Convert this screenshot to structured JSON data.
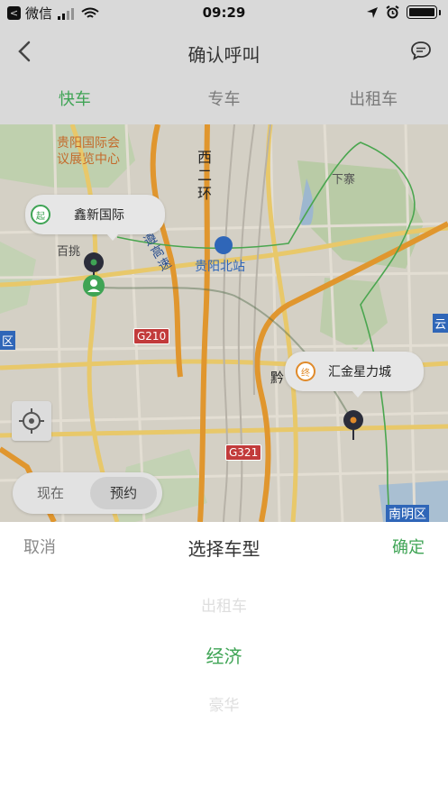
{
  "status_bar": {
    "carrier": "微信",
    "time": "09:29",
    "back_glyph": "<"
  },
  "nav": {
    "title": "确认呼叫",
    "back_icon": "back-arrow-icon",
    "chat_icon": "chat-bubble-icon"
  },
  "tabs": [
    {
      "label": "快车",
      "active": true
    },
    {
      "label": "专车",
      "active": false
    },
    {
      "label": "出租车",
      "active": false
    }
  ],
  "map": {
    "labels": {
      "expo": "贵阳国际会\n议展览中心",
      "xi_er_huan": "西\n二\n环",
      "xia_zhai": "下寨",
      "baitiao": "百挑",
      "expressway": "遵\n高\n速",
      "north_station": "贵阳北站",
      "g210": "G210",
      "g321": "G321",
      "qian": "黔",
      "yun": "云",
      "qu": "区",
      "nanming": "南明区"
    },
    "origin": {
      "badge": "起",
      "name": "鑫新国际"
    },
    "destination": {
      "badge": "终",
      "name": "汇金星力城"
    },
    "time_toggle": {
      "now": "现在",
      "reserve": "预约",
      "selected": "预约"
    },
    "colors": {
      "green": "#3fa455",
      "orange": "#e08a2a",
      "shield_red": "#c23b3b"
    }
  },
  "picker": {
    "cancel": "取消",
    "title": "选择车型",
    "confirm": "确定",
    "options": [
      "出租车",
      "经济",
      "豪华"
    ],
    "selected": "经济"
  }
}
